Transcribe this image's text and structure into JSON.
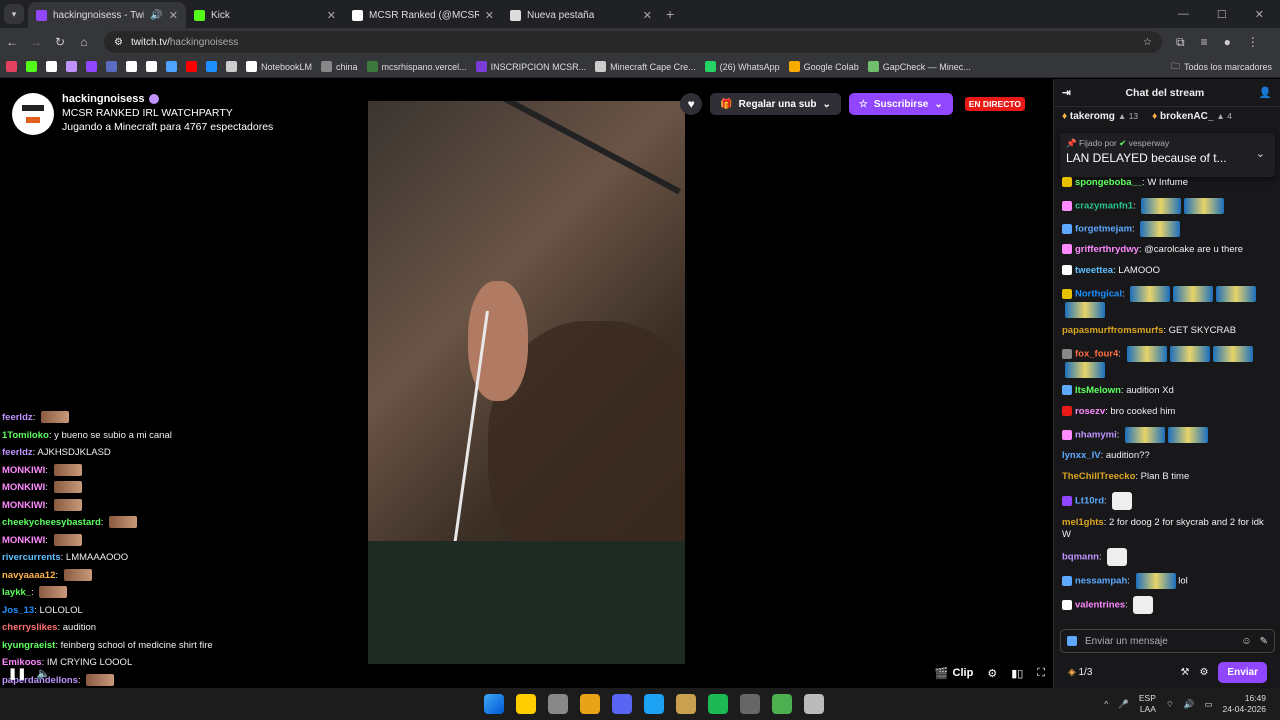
{
  "browser": {
    "tabs": [
      {
        "title": "hackingnoisess - Twitch",
        "active": true,
        "audio": true,
        "color": "#9147ff"
      },
      {
        "title": "Kick",
        "active": false,
        "color": "#53fc18"
      },
      {
        "title": "MCSR Ranked (@MCSR_Ranke",
        "active": false,
        "color": "#ffffff"
      },
      {
        "title": "Nueva pestaña",
        "active": false,
        "color": "#dddddd"
      }
    ],
    "url_host": "twitch.tv/",
    "url_path": "hackingnoisess",
    "bookmarks": [
      {
        "label": "NotebookLM",
        "color": "#ffffff"
      },
      {
        "label": "china",
        "color": "#888888"
      },
      {
        "label": "mcsrhispano.vercel...",
        "color": "#3b7a3b"
      },
      {
        "label": "INSCRIPCION MCSR...",
        "color": "#7b3bd6"
      },
      {
        "label": "Minecraft Cape Cre...",
        "color": "#cccccc"
      },
      {
        "label": "(26) WhatsApp",
        "color": "#25d366"
      },
      {
        "label": "Google Colab",
        "color": "#f9ab00"
      },
      {
        "label": "GapCheck — Minec...",
        "color": "#6fbf6f"
      }
    ],
    "all_bookmarks": "Todos los marcadores"
  },
  "channel": {
    "name": "hackingnoisess",
    "title": "MCSR RANKED IRL WATCHPARTY",
    "subtitle": "Jugando a Minecraft para 4767 espectadores",
    "gift_label": "Regalar una sub",
    "subscribe_label": "Suscribirse",
    "live_label": "EN DIRECTO"
  },
  "overlay_chat": [
    {
      "user": "feerldz",
      "text": "",
      "color": "#bf94ff"
    },
    {
      "user": "1Tomiloko",
      "text": "y bueno se subio a mi canal",
      "color": "#5dff5d"
    },
    {
      "user": "feerldz",
      "text": "AJKHSDJKLASD",
      "color": "#bf94ff"
    },
    {
      "user": "MONKIWI",
      "text": "",
      "color": "#ff8aff"
    },
    {
      "user": "MONKIWI",
      "text": "",
      "color": "#ff8aff"
    },
    {
      "user": "MONKIWI",
      "text": "",
      "color": "#ff8aff"
    },
    {
      "user": "cheekycheesybastard",
      "text": "",
      "color": "#5dff5d"
    },
    {
      "user": "MONKIWI",
      "text": "",
      "color": "#ff8aff"
    },
    {
      "user": "rivercurrents",
      "text": "LMMAAAOOO",
      "color": "#5dbfff"
    },
    {
      "user": "navyaaaa12",
      "text": "",
      "color": "#ffb34d"
    },
    {
      "user": "laykk_",
      "text": "",
      "color": "#5dff5d"
    },
    {
      "user": "Jos_13",
      "text": "LOLOLOL",
      "color": "#1e90ff"
    },
    {
      "user": "cherryslikes",
      "text": "audition",
      "color": "#ff6f6f"
    },
    {
      "user": "kyungraeist",
      "text": "feinberg school of medicine shirt fire",
      "color": "#5dff5d"
    },
    {
      "user": "Emikoos",
      "text": "IM CRYING LOOOL",
      "color": "#ff8aff"
    },
    {
      "user": "paperdandellons",
      "text": "",
      "color": "#bf94ff"
    }
  ],
  "player": {
    "clip_label": "Clip"
  },
  "chat": {
    "title": "Chat del stream",
    "leaders": [
      {
        "name": "takeromg",
        "points": "13"
      },
      {
        "name": "brokenAC_",
        "points": "4"
      }
    ],
    "pinned_by_prefix": "Fijado por",
    "pinned_by": "vesperway",
    "pinned_message": "LAN DELAYED because of t...",
    "messages": [
      {
        "user": "spongeboba__",
        "text": "W Infume",
        "color": "#5dff5d",
        "badge": "#e6c200",
        "emotes": 0,
        "face": false
      },
      {
        "user": "crazymanfn1",
        "text": "",
        "color": "#29c48a",
        "badge": "#ff8aff",
        "emotes": 2,
        "face": false
      },
      {
        "user": "forgetmejam",
        "text": "",
        "color": "#5da9ff",
        "badge": "#5da9ff",
        "emotes": 1,
        "face": false
      },
      {
        "user": "grifferthrydwy",
        "text": "@carolcake are u there",
        "color": "#ff8aff",
        "badge": "#ff8aff",
        "emotes": 0,
        "face": false
      },
      {
        "user": "tweettea",
        "text": "LAMOOO",
        "color": "#5dbfff",
        "badge": "#ffffff",
        "emotes": 0,
        "face": false
      },
      {
        "user": "Northgical",
        "text": "",
        "color": "#1e90ff",
        "badge": "#e6c200",
        "emotes": 4,
        "face": false
      },
      {
        "user": "papasmurffromsmurfs",
        "text": "GET SKYCRAB",
        "color": "#daa520",
        "badge": "",
        "emotes": 0,
        "face": false
      },
      {
        "user": "fox_four4",
        "text": "",
        "color": "#ff6f3f",
        "badge": "#888888",
        "emotes": 4,
        "face": false
      },
      {
        "user": "ItsMelown",
        "text": "audition Xd",
        "color": "#5dff5d",
        "badge": "#5da9ff",
        "emotes": 0,
        "face": false
      },
      {
        "user": "rosezv",
        "text": "bro cooked him",
        "color": "#ff8aff",
        "badge": "#e91916",
        "emotes": 0,
        "face": false
      },
      {
        "user": "nhamymi",
        "text": "",
        "color": "#bf94ff",
        "badge": "#ff8aff",
        "emotes": 2,
        "face": false
      },
      {
        "user": "lynxx_IV",
        "text": "audition??",
        "color": "#5da9ff",
        "badge": "",
        "emotes": 0,
        "face": false
      },
      {
        "user": "TheChillTreecko",
        "text": "Plan B time",
        "color": "#daa520",
        "badge": "",
        "emotes": 0,
        "face": false
      },
      {
        "user": "Lt10rd",
        "text": "",
        "color": "#5da9ff",
        "badge": "#9147ff",
        "emotes": 0,
        "face": true
      },
      {
        "user": "mel1ghts",
        "text": "2 for doog 2 for skycrab and 2 for idk W",
        "color": "#daa520",
        "badge": "",
        "emotes": 0,
        "face": false
      },
      {
        "user": "bqmann",
        "text": "",
        "color": "#bf94ff",
        "badge": "",
        "emotes": 0,
        "face": true
      },
      {
        "user": "nessampah",
        "text": "lol",
        "color": "#5da9ff",
        "badge": "#5da9ff",
        "emotes": 1,
        "face": false
      },
      {
        "user": "valentrines",
        "text": "",
        "color": "#ff8aff",
        "badge": "#ffffff",
        "emotes": 0,
        "face": true
      }
    ],
    "input_placeholder": "Enviar un mensaje",
    "points": "1/3",
    "send_label": "Enviar"
  },
  "taskbar": {
    "lang": "ESP",
    "lang2": "LAA",
    "time": "16:49",
    "date": "24-04-2026"
  }
}
